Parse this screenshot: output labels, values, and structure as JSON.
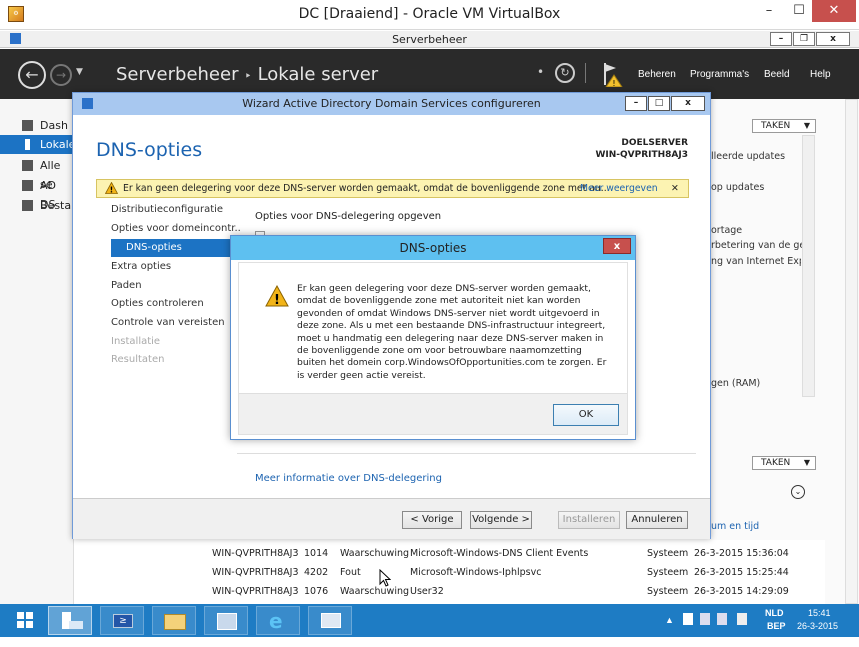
{
  "vbox": {
    "title": "DC  [Draaiend] - Oracle VM VirtualBox",
    "min": "–",
    "max": "☐",
    "close": "✕"
  },
  "server_manager": {
    "window_title": "Serverbeheer",
    "breadcrumb_root": "Serverbeheer",
    "breadcrumb_separator": "‣",
    "breadcrumb_current": "Lokale server",
    "menu": [
      "Beheren",
      "Programma's",
      "Beeld",
      "Help"
    ],
    "sidebar": [
      {
        "label": "Dash"
      },
      {
        "label": "Lokale"
      },
      {
        "label": "Alle se"
      },
      {
        "label": "AD DS"
      },
      {
        "label": "Bestar"
      }
    ]
  },
  "background_panel": {
    "taken_label": "TAKEN",
    "lines": [
      "lleerde updates",
      "op updates",
      "ortage",
      "rbetering van de geb",
      "ng van Internet Exple",
      "gen (RAM)",
      "um en tijd"
    ]
  },
  "events": [
    {
      "server": "WIN-QVPRITH8AJ3",
      "id": "1014",
      "level": "Waarschuwing",
      "source": "Microsoft-Windows-DNS Client Events",
      "log": "Systeem",
      "date": "26-3-2015 15:36:04"
    },
    {
      "server": "WIN-QVPRITH8AJ3",
      "id": "4202",
      "level": "Fout",
      "source": "Microsoft-Windows-Iphlpsvc",
      "log": "Systeem",
      "date": "26-3-2015 15:25:44"
    },
    {
      "server": "WIN-QVPRITH8AJ3",
      "id": "1076",
      "level": "Waarschuwing",
      "source": "User32",
      "log": "Systeem",
      "date": "26-3-2015 14:29:09"
    }
  ],
  "wizard": {
    "title": "Wizard Active Directory Domain Services configureren",
    "heading": "DNS-opties",
    "target_label": "DOELSERVER",
    "target_server": "WIN-QVPRITH8AJ3",
    "warning_text": "Er kan geen delegering voor deze DNS-server worden gemaakt, omdat de bovenliggende zone met au...",
    "warning_more": "Meer weergeven",
    "nav": [
      {
        "label": "Distributieconfiguratie",
        "state": "normal"
      },
      {
        "label": "Opties voor domeincontr...",
        "state": "normal"
      },
      {
        "label": "DNS-opties",
        "state": "active"
      },
      {
        "label": "Extra opties",
        "state": "normal"
      },
      {
        "label": "Paden",
        "state": "normal"
      },
      {
        "label": "Opties controleren",
        "state": "normal"
      },
      {
        "label": "Controle van vereisten",
        "state": "normal"
      },
      {
        "label": "Installatie",
        "state": "disabled"
      },
      {
        "label": "Resultaten",
        "state": "disabled"
      }
    ],
    "content_label": "Opties voor DNS-delegering opgeven",
    "info_link": "Meer informatie over DNS-delegering",
    "buttons": {
      "back": "< Vorige",
      "next": "Volgende >",
      "install": "Installeren",
      "cancel": "Annuleren"
    }
  },
  "message_box": {
    "title": "DNS-opties",
    "close": "x",
    "text": "Er kan geen delegering voor deze DNS-server worden gemaakt, omdat de bovenliggende zone met autoriteit niet kan worden gevonden of omdat Windows DNS-server niet wordt uitgevoerd in deze zone. Als u met een bestaande DNS-infrastructuur integreert, moet u handmatig een delegering naar deze DNS-server maken in de bovenliggende zone om voor betrouwbare naamomzetting buiten het domein corp.WindowsOfOpportunities.com te zorgen. Er is verder geen actie vereist.",
    "ok": "OK"
  },
  "taskbar": {
    "lang_top": "NLD",
    "lang_bottom": "BEP",
    "time": "15:41",
    "date": "26-3-2015"
  },
  "colors": {
    "accent": "#1c73c4",
    "header": "#2a2a2a",
    "taskbar": "#1e7cc4",
    "warning_bg": "#fcf3b2"
  }
}
